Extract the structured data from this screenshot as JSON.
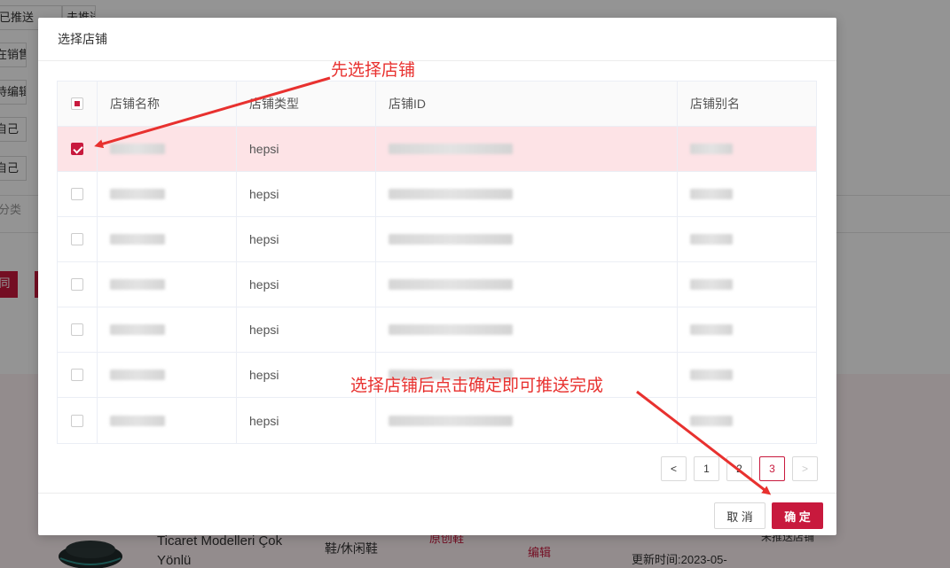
{
  "background": {
    "buttons": [
      "已推送",
      "未推送",
      "在销售",
      "待编辑",
      "自己",
      "自己"
    ],
    "category_label": "分类",
    "red_button_label": "同",
    "product_title_line1": "Ticaret Modelleri Çok",
    "product_title_line2": "Yönlü",
    "product_category": "鞋/休闲鞋",
    "product_tag": "原创鞋",
    "edit_link": "编辑",
    "updated_time": "更新时间:2023-05-",
    "right_cell": "未推送店铺"
  },
  "modal": {
    "title": "选择店铺",
    "columns": [
      "店铺名称",
      "店铺类型",
      "店铺ID",
      "店铺别名"
    ],
    "rows": [
      {
        "type": "hepsi",
        "selected": true
      },
      {
        "type": "hepsi",
        "selected": false
      },
      {
        "type": "hepsi",
        "selected": false
      },
      {
        "type": "hepsi",
        "selected": false
      },
      {
        "type": "hepsi",
        "selected": false
      },
      {
        "type": "hepsi",
        "selected": false
      },
      {
        "type": "hepsi",
        "selected": false
      }
    ],
    "pagination": {
      "prev": "<",
      "pages": [
        "1",
        "2",
        "3"
      ],
      "current": "3",
      "next": ">"
    },
    "cancel_label": "取 消",
    "ok_label": "确 定"
  },
  "annotations": {
    "step1": "先选择店铺",
    "step2": "选择店铺后点击确定即可推送完成",
    "color": "#e8312f"
  },
  "colors": {
    "accent": "#c8193d",
    "selected_row": "#fde3e6"
  }
}
